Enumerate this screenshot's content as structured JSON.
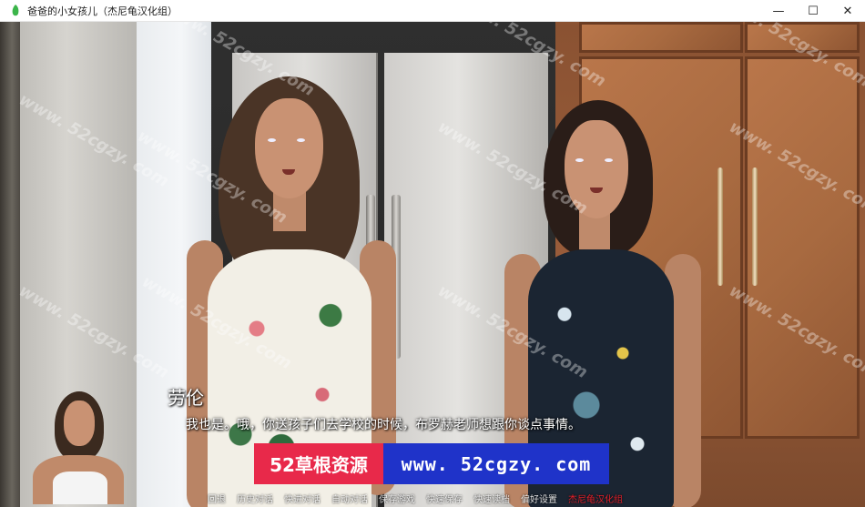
{
  "window": {
    "title": "爸爸的小女孩儿（杰尼龟汉化组）",
    "icon": "game-icon",
    "controls": {
      "minimize": "—",
      "maximize": "☐",
      "close": "✕"
    }
  },
  "dialogue": {
    "speaker": "劳伦",
    "text": "我也是。哦，你送孩子们去学校的时候，布罗赫老师想跟你谈点事情。"
  },
  "banner": {
    "left_text": "52草根资源",
    "right_text": "www. 52cgzy. com",
    "colors": {
      "left": "#e8294a",
      "right": "#1f33c9"
    }
  },
  "watermark": {
    "text": "www. 52cgzy. com"
  },
  "quick_menu": {
    "items": [
      "回退",
      "历史对话",
      "快进对话",
      "自动对话",
      "保存游戏",
      "快速保存",
      "快速读档",
      "偏好设置",
      "杰尼龟汉化组"
    ]
  },
  "colors": {
    "dialogue_text": "#ffffff",
    "quick_menu_accent": "#e0202a"
  }
}
